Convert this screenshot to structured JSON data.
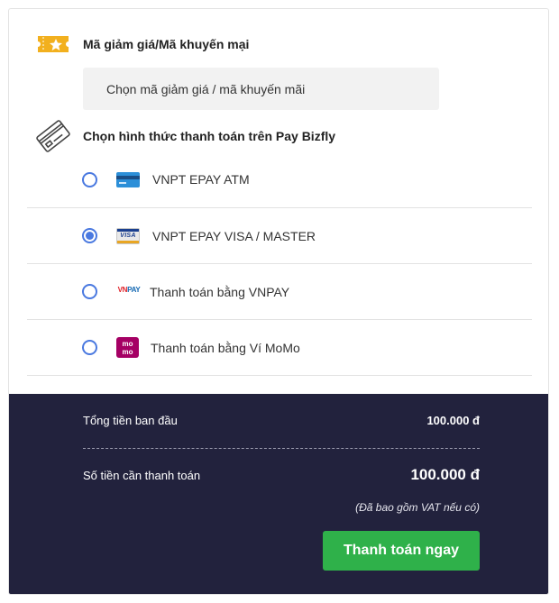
{
  "coupon": {
    "title": "Mã giảm giá/Mã khuyến mại",
    "field_text": "Chọn mã giảm giá / mã khuyến mãi",
    "icon": "ticket-star-icon"
  },
  "payment": {
    "title": "Chọn hình thức thanh toán trên Pay Bizfly",
    "icon": "credit-card-icon",
    "options": [
      {
        "label": "VNPT EPAY ATM",
        "icon": "atm-card-icon",
        "selected": false
      },
      {
        "label": "VNPT EPAY VISA / MASTER",
        "icon": "visa-card-icon",
        "selected": true
      },
      {
        "label": "Thanh toán bằng VNPAY",
        "icon": "vnpay-logo-icon",
        "selected": false
      },
      {
        "label": "Thanh toán bằng Ví MoMo",
        "icon": "momo-logo-icon",
        "selected": false
      }
    ],
    "logo_text": {
      "visa": "VISA",
      "vnpay_red": "VN",
      "vnpay_blue": "PAY",
      "momo_top": "mo",
      "momo_bottom": "mo"
    }
  },
  "summary": {
    "original_label": "Tổng tiền ban đầu",
    "original_value": "100.000 đ",
    "total_label": "Số tiền cần thanh toán",
    "total_value": "100.000 đ",
    "vat_note": "(Đã bao gồm VAT nếu có)",
    "pay_button": "Thanh toán ngay"
  },
  "colors": {
    "accent": "#4a79e0",
    "summary_bg": "#22223d",
    "pay_button": "#2fb14a",
    "coupon_icon": "#f2b01e"
  }
}
